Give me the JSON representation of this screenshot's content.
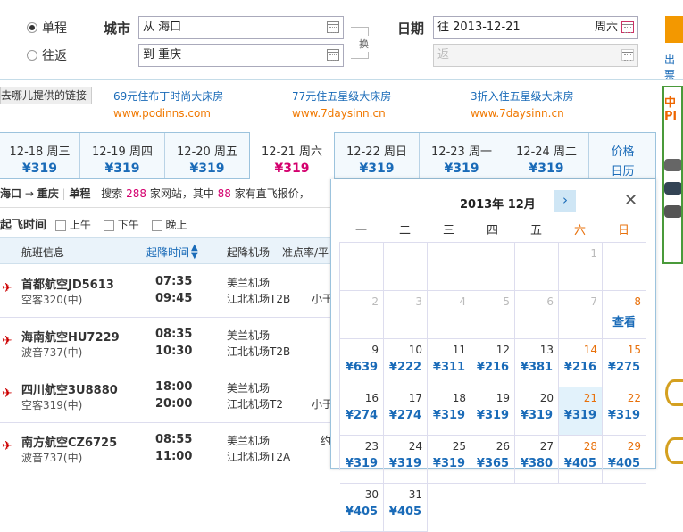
{
  "search": {
    "oneway": "单程",
    "roundtrip": "往返",
    "city_label": "城市",
    "from": "从 海口",
    "to": "到 重庆",
    "swap": "换",
    "date_label": "日期",
    "depart": "往 2013-12-21",
    "depart_weekday": "周六",
    "return_ph": "返",
    "search_link": "出票"
  },
  "ads": {
    "prefix": "去哪儿提供的链接",
    "items": [
      {
        "t": "69元住布丁时尚大床房",
        "u": "www.podinns.com"
      },
      {
        "t": "77元住五星级大床房",
        "u": "www.7daysinn.cn"
      },
      {
        "t": "3折入住五星级大床房",
        "u": "www.7daysinn.cn"
      }
    ]
  },
  "datebar": [
    {
      "d": "12-18 周三",
      "p": "¥319"
    },
    {
      "d": "12-19 周四",
      "p": "¥319"
    },
    {
      "d": "12-20 周五",
      "p": "¥319"
    },
    {
      "d": "12-21 周六",
      "p": "¥319"
    },
    {
      "d": "12-22 周日",
      "p": "¥319"
    },
    {
      "d": "12-23 周一",
      "p": "¥319"
    },
    {
      "d": "12-24 周二",
      "p": "¥319"
    }
  ],
  "price_cal": {
    "l1": "价格",
    "l2": "日历"
  },
  "route": {
    "from": "海口",
    "to": "重庆",
    "type": "单程",
    "s1": "搜索",
    "c1": "288",
    "s2": "家网站，其中",
    "c2": "88",
    "s3": "家有直飞报价，"
  },
  "filter": {
    "label": "起飞时间",
    "am": "上午",
    "pm": "下午",
    "eve": "晚上"
  },
  "head": {
    "info": "航班信息",
    "time": "起降时间",
    "airport": "起降机场",
    "rate": "准点率/平"
  },
  "flights": [
    {
      "name": "首都航空JD5613",
      "plane": "空客320(中)",
      "t1": "07:35",
      "t2": "09:45",
      "a1": "美兰机场",
      "a2": "江北机场T2B",
      "x": "小于"
    },
    {
      "name": "海南航空HU7229",
      "plane": "波音737(中)",
      "t1": "08:35",
      "t2": "10:30",
      "a1": "美兰机场",
      "a2": "江北机场T2B",
      "x": ""
    },
    {
      "name": "四川航空3U8880",
      "plane": "空客319(中)",
      "t1": "18:00",
      "t2": "20:00",
      "a1": "美兰机场",
      "a2": "江北机场T2",
      "x": "小于"
    },
    {
      "name": "南方航空CZ6725",
      "plane": "波音737(中)",
      "t1": "08:55",
      "t2": "11:00",
      "a1": "美兰机场",
      "a2": "江北机场T2A",
      "x": "约"
    }
  ],
  "calendar": {
    "title": "2013年 12月",
    "weekdays": [
      "一",
      "二",
      "三",
      "四",
      "五",
      "六",
      "日"
    ],
    "days": [
      {
        "n": "1",
        "p": "",
        "c": 5,
        "r": 0,
        "g": true
      },
      {
        "n": "2",
        "p": "",
        "c": 0,
        "r": 1,
        "g": true
      },
      {
        "n": "3",
        "p": "",
        "c": 1,
        "r": 1,
        "g": true
      },
      {
        "n": "4",
        "p": "",
        "c": 2,
        "r": 1,
        "g": true
      },
      {
        "n": "5",
        "p": "",
        "c": 3,
        "r": 1,
        "g": true
      },
      {
        "n": "6",
        "p": "",
        "c": 4,
        "r": 1,
        "g": true
      },
      {
        "n": "7",
        "p": "",
        "c": 5,
        "r": 1,
        "g": true
      },
      {
        "n": "8",
        "p": "查看",
        "c": 6,
        "r": 1
      },
      {
        "n": "9",
        "p": "¥639",
        "c": 0,
        "r": 2
      },
      {
        "n": "10",
        "p": "¥222",
        "c": 1,
        "r": 2
      },
      {
        "n": "11",
        "p": "¥311",
        "c": 2,
        "r": 2
      },
      {
        "n": "12",
        "p": "¥216",
        "c": 3,
        "r": 2
      },
      {
        "n": "13",
        "p": "¥381",
        "c": 4,
        "r": 2
      },
      {
        "n": "14",
        "p": "¥216",
        "c": 5,
        "r": 2
      },
      {
        "n": "15",
        "p": "¥275",
        "c": 6,
        "r": 2
      },
      {
        "n": "16",
        "p": "¥274",
        "c": 0,
        "r": 3
      },
      {
        "n": "17",
        "p": "¥274",
        "c": 1,
        "r": 3
      },
      {
        "n": "18",
        "p": "¥319",
        "c": 2,
        "r": 3
      },
      {
        "n": "19",
        "p": "¥319",
        "c": 3,
        "r": 3
      },
      {
        "n": "20",
        "p": "¥319",
        "c": 4,
        "r": 3
      },
      {
        "n": "21",
        "p": "¥319",
        "c": 5,
        "r": 3,
        "sel": true
      },
      {
        "n": "22",
        "p": "¥319",
        "c": 6,
        "r": 3
      },
      {
        "n": "23",
        "p": "¥319",
        "c": 0,
        "r": 4
      },
      {
        "n": "24",
        "p": "¥319",
        "c": 1,
        "r": 4
      },
      {
        "n": "25",
        "p": "¥319",
        "c": 2,
        "r": 4
      },
      {
        "n": "26",
        "p": "¥365",
        "c": 3,
        "r": 4
      },
      {
        "n": "27",
        "p": "¥380",
        "c": 4,
        "r": 4
      },
      {
        "n": "28",
        "p": "¥405",
        "c": 5,
        "r": 4
      },
      {
        "n": "29",
        "p": "¥405",
        "c": 6,
        "r": 4
      },
      {
        "n": "30",
        "p": "¥405",
        "c": 0,
        "r": 5
      },
      {
        "n": "31",
        "p": "¥405",
        "c": 1,
        "r": 5
      }
    ]
  },
  "side": {
    "t1": "中",
    "t2": "Pl"
  },
  "colors": {
    "accent": "#1a6bb8",
    "weekend": "#e8700a",
    "price_sel": "#d4006e",
    "orange_btn": "#f39800"
  }
}
